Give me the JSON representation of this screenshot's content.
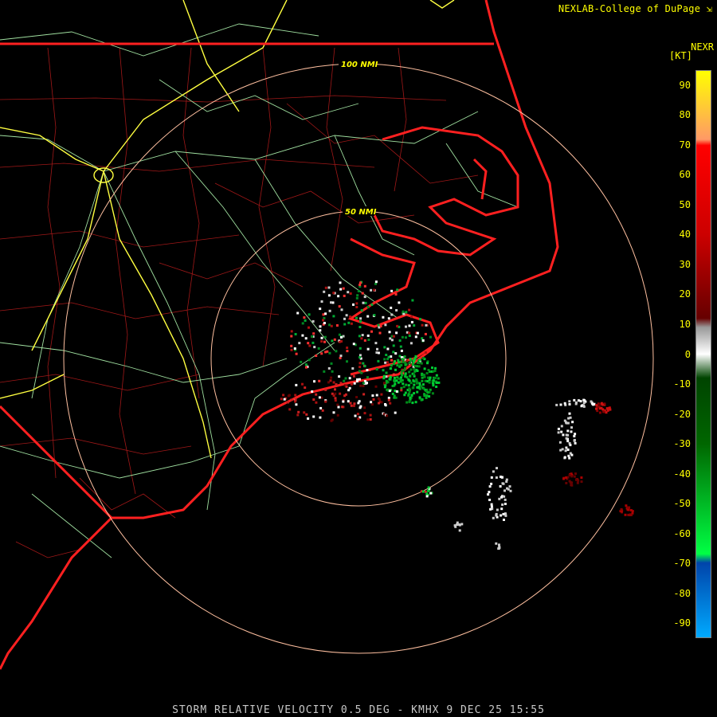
{
  "credit": "NEXLAB-College of DuPage",
  "credit_icon": "external-link-icon",
  "product_code": "NEXR",
  "unit_label": "[KT]",
  "footer_caption": "STORM RELATIVE VELOCITY 0.5 DEG - KMHX 9 DEC 25 15:55",
  "range_rings": [
    {
      "label": "50 NMI",
      "range_nmi": 50
    },
    {
      "label": "100 NMI",
      "range_nmi": 100
    }
  ],
  "legend": {
    "ticks": [
      "90",
      "80",
      "70",
      "60",
      "50",
      "40",
      "30",
      "20",
      "10",
      "0",
      "-10",
      "-20",
      "-30",
      "-40",
      "-50",
      "-60",
      "-70",
      "-80",
      "-90"
    ],
    "color_stops": [
      {
        "value": 95,
        "color": "#ffff00"
      },
      {
        "value": 72,
        "color": "#ff9966"
      },
      {
        "value": 70,
        "color": "#ff0000"
      },
      {
        "value": 40,
        "color": "#cc0000"
      },
      {
        "value": 12,
        "color": "#660000"
      },
      {
        "value": 9,
        "color": "#999999"
      },
      {
        "value": 0,
        "color": "#ffffff"
      },
      {
        "value": -8,
        "color": "#004400"
      },
      {
        "value": -30,
        "color": "#006600"
      },
      {
        "value": -67,
        "color": "#00ff44"
      },
      {
        "value": -70,
        "color": "#0044aa"
      },
      {
        "value": -95,
        "color": "#00aaff"
      }
    ]
  },
  "colors": {
    "state_border": "#ff2020",
    "county_line": "#a01818",
    "highway": "#ffff40",
    "road": "#a0e0a0",
    "range_ring": "#ffc0a0",
    "label": "#ffff00"
  }
}
